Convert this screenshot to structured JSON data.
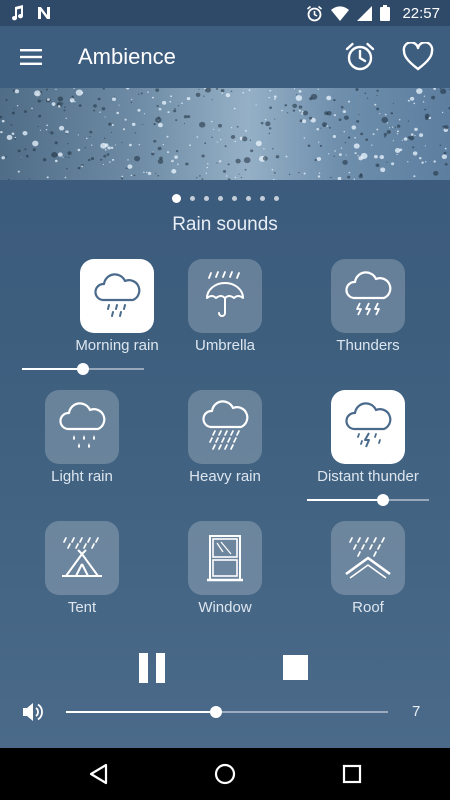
{
  "status_bar": {
    "left_icons": [
      "music-note-icon",
      "n-notification-icon"
    ],
    "right_icons": [
      "alarm-icon",
      "wifi-icon",
      "signal-icon",
      "battery-icon"
    ],
    "time": "22:57"
  },
  "app_bar": {
    "title": "Ambience",
    "menu_icon": "hamburger-menu-icon",
    "actions": [
      "alarm-clock-icon",
      "heart-icon"
    ]
  },
  "banner": {
    "image": "rain-drops-on-glass",
    "page_count": 8,
    "current_page": 1
  },
  "section": {
    "title": "Rain sounds"
  },
  "sounds": [
    {
      "label": "Morning rain",
      "icon": "cloud-rain-icon",
      "active": true,
      "volume": 0.5
    },
    {
      "label": "Umbrella",
      "icon": "umbrella-icon",
      "active": false
    },
    {
      "label": "Thunders",
      "icon": "cloud-lightning-icon",
      "active": false
    },
    {
      "label": "Light rain",
      "icon": "cloud-light-rain-icon",
      "active": false
    },
    {
      "label": "Heavy rain",
      "icon": "cloud-heavy-rain-icon",
      "active": false
    },
    {
      "label": "Distant thunder",
      "icon": "cloud-thunder-icon",
      "active": true,
      "volume": 0.62
    },
    {
      "label": "Tent",
      "icon": "tent-icon",
      "active": false
    },
    {
      "label": "Window",
      "icon": "window-icon",
      "active": false
    },
    {
      "label": "Roof",
      "icon": "roof-icon",
      "active": false
    }
  ],
  "playback": {
    "pause_icon": "pause-icon",
    "stop_icon": "stop-icon"
  },
  "master_volume": {
    "icon": "speaker-icon",
    "value": 7,
    "level": 0.47
  },
  "nav_bar": {
    "buttons": [
      "back-icon",
      "home-icon",
      "recents-icon"
    ]
  },
  "colors": {
    "primary": "#3e5e80",
    "status_bar": "#2f4a68",
    "text": "#ffffff"
  }
}
